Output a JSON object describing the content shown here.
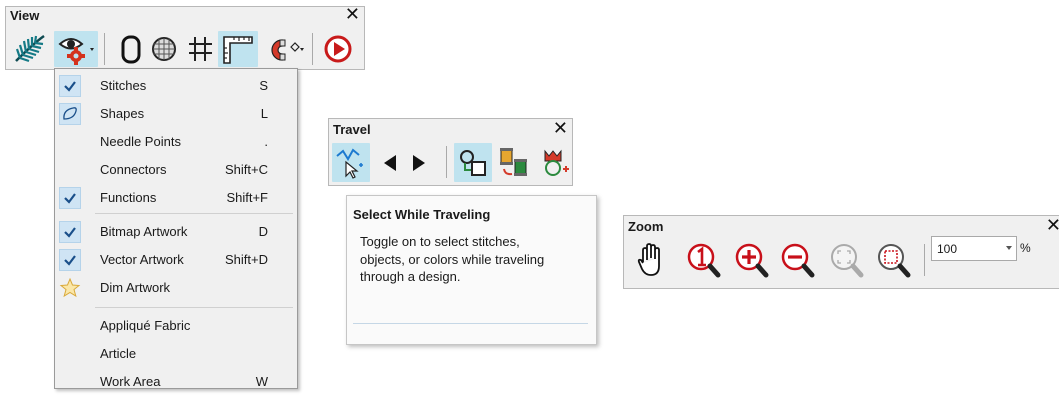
{
  "view_toolbar": {
    "title": "View",
    "close_glyph": "✕",
    "tools": [
      "stitches-feather-icon",
      "show-options-eye-gear-icon",
      "hoop-icon",
      "grid-disc-icon",
      "grid-icon",
      "ruler-icon",
      "magnet-snap-icon",
      "play-record-icon"
    ]
  },
  "view_menu": {
    "items": [
      {
        "label": "Stitches",
        "shortcut": "S",
        "checked": true
      },
      {
        "label": "Shapes",
        "shortcut": "L",
        "checked": true,
        "icon": "shape-outline-icon"
      },
      {
        "label": "Needle Points",
        "shortcut": ".",
        "checked": false
      },
      {
        "label": "Connectors",
        "shortcut": "Shift+C",
        "checked": false
      },
      {
        "label": "Functions",
        "shortcut": "Shift+F",
        "checked": true
      },
      {
        "label": "Bitmap Artwork",
        "shortcut": "D",
        "checked": true
      },
      {
        "label": "Vector Artwork",
        "shortcut": "Shift+D",
        "checked": true
      },
      {
        "label": "Dim Artwork",
        "shortcut": "",
        "checked": false,
        "icon": "dim-artwork-star-icon"
      },
      {
        "label": "Appliqué Fabric",
        "shortcut": "",
        "checked": false
      },
      {
        "label": "Article",
        "shortcut": "",
        "checked": false
      },
      {
        "label": "Work Area",
        "shortcut": "W",
        "checked": false
      }
    ]
  },
  "travel_toolbar": {
    "title": "Travel",
    "close_glyph": "✕",
    "tools": [
      "select-while-traveling-icon",
      "travel-back-icon",
      "travel-forward-icon",
      "travel-objects-icon",
      "travel-colors-icon",
      "travel-functions-icon"
    ]
  },
  "tooltip": {
    "title": "Select While Traveling",
    "body": "Toggle on to select stitches, objects, or colors while traveling through a design."
  },
  "zoom_toolbar": {
    "title": "Zoom",
    "close_glyph": "✕",
    "zoom_value": "100",
    "unit": "%",
    "tools": [
      "pan-hand-icon",
      "zoom-1-to-1-icon",
      "zoom-in-icon",
      "zoom-out-icon",
      "zoom-fit-icon",
      "zoom-box-icon"
    ]
  },
  "colors": {
    "accent": "#1a4f8a",
    "active_bg": "#bfe3ef",
    "zoom_red": "#c8101a"
  }
}
